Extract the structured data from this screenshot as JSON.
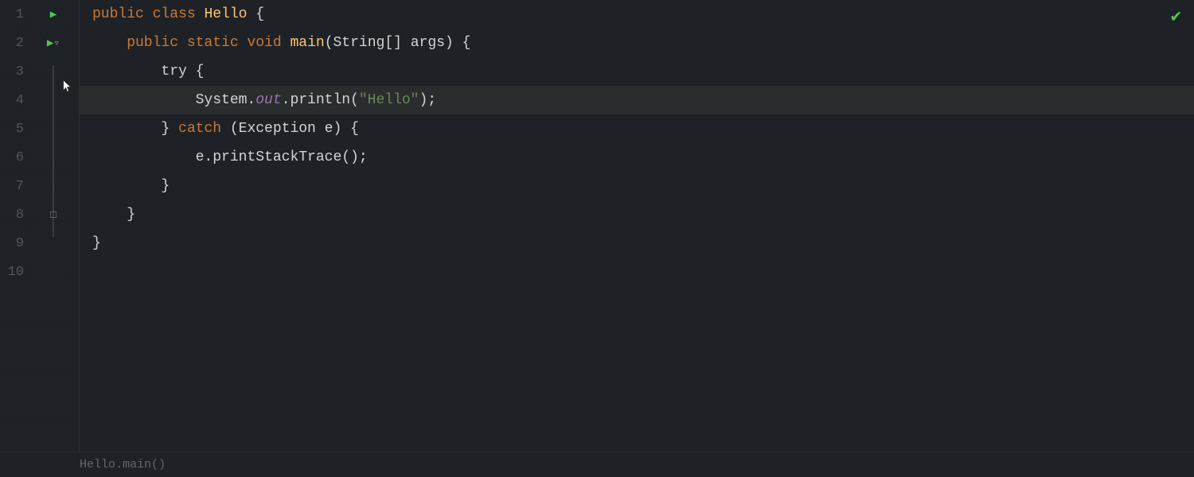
{
  "editor": {
    "background": "#1e2227",
    "checkmark": "✔",
    "lines": [
      {
        "number": 1,
        "gutter": {
          "run": true,
          "fold": false,
          "foldClose": false
        },
        "tokens": [
          {
            "text": "public ",
            "class": "kw"
          },
          {
            "text": "class ",
            "class": "kw"
          },
          {
            "text": "Hello",
            "class": "class-name"
          },
          {
            "text": " {",
            "class": "plain"
          }
        ]
      },
      {
        "number": 2,
        "gutter": {
          "run": true,
          "fold": true,
          "foldClose": false
        },
        "tokens": [
          {
            "text": "    public ",
            "class": "kw"
          },
          {
            "text": "static ",
            "class": "kw"
          },
          {
            "text": "void ",
            "class": "kw"
          },
          {
            "text": "main",
            "class": "method"
          },
          {
            "text": "(",
            "class": "plain"
          },
          {
            "text": "String",
            "class": "plain"
          },
          {
            "text": "[] args) {",
            "class": "plain"
          }
        ]
      },
      {
        "number": 3,
        "gutter": {
          "run": false,
          "fold": false,
          "foldClose": false
        },
        "tokens": [
          {
            "text": "        try {",
            "class": "plain"
          }
        ]
      },
      {
        "number": 4,
        "gutter": {
          "run": false,
          "fold": false,
          "foldClose": false
        },
        "active": true,
        "tokens": [
          {
            "text": "            System.",
            "class": "sys"
          },
          {
            "text": "out",
            "class": "italic"
          },
          {
            "text": ".println(",
            "class": "sys"
          },
          {
            "text": "\"Hello\"",
            "class": "string"
          },
          {
            "text": ");",
            "class": "plain"
          }
        ]
      },
      {
        "number": 5,
        "gutter": {
          "run": false,
          "fold": false,
          "foldClose": false
        },
        "tokens": [
          {
            "text": "        } ",
            "class": "plain"
          },
          {
            "text": "catch ",
            "class": "kw"
          },
          {
            "text": "(Exception e) {",
            "class": "plain"
          }
        ]
      },
      {
        "number": 6,
        "gutter": {
          "run": false,
          "fold": false,
          "foldClose": false
        },
        "tokens": [
          {
            "text": "            e.printStackTrace();",
            "class": "plain"
          }
        ]
      },
      {
        "number": 7,
        "gutter": {
          "run": false,
          "fold": false,
          "foldClose": false
        },
        "tokens": [
          {
            "text": "        }",
            "class": "plain"
          }
        ]
      },
      {
        "number": 8,
        "gutter": {
          "run": false,
          "fold": false,
          "foldClose": true
        },
        "tokens": [
          {
            "text": "    }",
            "class": "plain"
          }
        ]
      },
      {
        "number": 9,
        "gutter": {
          "run": false,
          "fold": false,
          "foldClose": false
        },
        "tokens": [
          {
            "text": "}",
            "class": "plain"
          }
        ]
      },
      {
        "number": 10,
        "gutter": {
          "run": false,
          "fold": false,
          "foldClose": false
        },
        "tokens": []
      }
    ],
    "bottom_text": "Hello.main()"
  }
}
